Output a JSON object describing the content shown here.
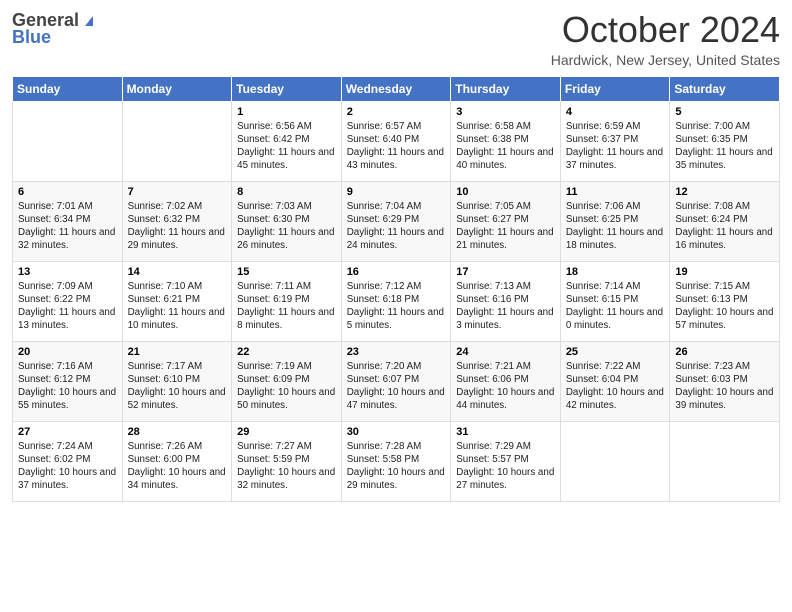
{
  "header": {
    "logo_line1": "General",
    "logo_line2": "Blue",
    "month_title": "October 2024",
    "location": "Hardwick, New Jersey, United States"
  },
  "weekdays": [
    "Sunday",
    "Monday",
    "Tuesday",
    "Wednesday",
    "Thursday",
    "Friday",
    "Saturday"
  ],
  "weeks": [
    [
      null,
      null,
      {
        "day": 1,
        "sunrise": "Sunrise: 6:56 AM",
        "sunset": "Sunset: 6:42 PM",
        "daylight": "Daylight: 11 hours and 45 minutes."
      },
      {
        "day": 2,
        "sunrise": "Sunrise: 6:57 AM",
        "sunset": "Sunset: 6:40 PM",
        "daylight": "Daylight: 11 hours and 43 minutes."
      },
      {
        "day": 3,
        "sunrise": "Sunrise: 6:58 AM",
        "sunset": "Sunset: 6:38 PM",
        "daylight": "Daylight: 11 hours and 40 minutes."
      },
      {
        "day": 4,
        "sunrise": "Sunrise: 6:59 AM",
        "sunset": "Sunset: 6:37 PM",
        "daylight": "Daylight: 11 hours and 37 minutes."
      },
      {
        "day": 5,
        "sunrise": "Sunrise: 7:00 AM",
        "sunset": "Sunset: 6:35 PM",
        "daylight": "Daylight: 11 hours and 35 minutes."
      }
    ],
    [
      {
        "day": 6,
        "sunrise": "Sunrise: 7:01 AM",
        "sunset": "Sunset: 6:34 PM",
        "daylight": "Daylight: 11 hours and 32 minutes."
      },
      {
        "day": 7,
        "sunrise": "Sunrise: 7:02 AM",
        "sunset": "Sunset: 6:32 PM",
        "daylight": "Daylight: 11 hours and 29 minutes."
      },
      {
        "day": 8,
        "sunrise": "Sunrise: 7:03 AM",
        "sunset": "Sunset: 6:30 PM",
        "daylight": "Daylight: 11 hours and 26 minutes."
      },
      {
        "day": 9,
        "sunrise": "Sunrise: 7:04 AM",
        "sunset": "Sunset: 6:29 PM",
        "daylight": "Daylight: 11 hours and 24 minutes."
      },
      {
        "day": 10,
        "sunrise": "Sunrise: 7:05 AM",
        "sunset": "Sunset: 6:27 PM",
        "daylight": "Daylight: 11 hours and 21 minutes."
      },
      {
        "day": 11,
        "sunrise": "Sunrise: 7:06 AM",
        "sunset": "Sunset: 6:25 PM",
        "daylight": "Daylight: 11 hours and 18 minutes."
      },
      {
        "day": 12,
        "sunrise": "Sunrise: 7:08 AM",
        "sunset": "Sunset: 6:24 PM",
        "daylight": "Daylight: 11 hours and 16 minutes."
      }
    ],
    [
      {
        "day": 13,
        "sunrise": "Sunrise: 7:09 AM",
        "sunset": "Sunset: 6:22 PM",
        "daylight": "Daylight: 11 hours and 13 minutes."
      },
      {
        "day": 14,
        "sunrise": "Sunrise: 7:10 AM",
        "sunset": "Sunset: 6:21 PM",
        "daylight": "Daylight: 11 hours and 10 minutes."
      },
      {
        "day": 15,
        "sunrise": "Sunrise: 7:11 AM",
        "sunset": "Sunset: 6:19 PM",
        "daylight": "Daylight: 11 hours and 8 minutes."
      },
      {
        "day": 16,
        "sunrise": "Sunrise: 7:12 AM",
        "sunset": "Sunset: 6:18 PM",
        "daylight": "Daylight: 11 hours and 5 minutes."
      },
      {
        "day": 17,
        "sunrise": "Sunrise: 7:13 AM",
        "sunset": "Sunset: 6:16 PM",
        "daylight": "Daylight: 11 hours and 3 minutes."
      },
      {
        "day": 18,
        "sunrise": "Sunrise: 7:14 AM",
        "sunset": "Sunset: 6:15 PM",
        "daylight": "Daylight: 11 hours and 0 minutes."
      },
      {
        "day": 19,
        "sunrise": "Sunrise: 7:15 AM",
        "sunset": "Sunset: 6:13 PM",
        "daylight": "Daylight: 10 hours and 57 minutes."
      }
    ],
    [
      {
        "day": 20,
        "sunrise": "Sunrise: 7:16 AM",
        "sunset": "Sunset: 6:12 PM",
        "daylight": "Daylight: 10 hours and 55 minutes."
      },
      {
        "day": 21,
        "sunrise": "Sunrise: 7:17 AM",
        "sunset": "Sunset: 6:10 PM",
        "daylight": "Daylight: 10 hours and 52 minutes."
      },
      {
        "day": 22,
        "sunrise": "Sunrise: 7:19 AM",
        "sunset": "Sunset: 6:09 PM",
        "daylight": "Daylight: 10 hours and 50 minutes."
      },
      {
        "day": 23,
        "sunrise": "Sunrise: 7:20 AM",
        "sunset": "Sunset: 6:07 PM",
        "daylight": "Daylight: 10 hours and 47 minutes."
      },
      {
        "day": 24,
        "sunrise": "Sunrise: 7:21 AM",
        "sunset": "Sunset: 6:06 PM",
        "daylight": "Daylight: 10 hours and 44 minutes."
      },
      {
        "day": 25,
        "sunrise": "Sunrise: 7:22 AM",
        "sunset": "Sunset: 6:04 PM",
        "daylight": "Daylight: 10 hours and 42 minutes."
      },
      {
        "day": 26,
        "sunrise": "Sunrise: 7:23 AM",
        "sunset": "Sunset: 6:03 PM",
        "daylight": "Daylight: 10 hours and 39 minutes."
      }
    ],
    [
      {
        "day": 27,
        "sunrise": "Sunrise: 7:24 AM",
        "sunset": "Sunset: 6:02 PM",
        "daylight": "Daylight: 10 hours and 37 minutes."
      },
      {
        "day": 28,
        "sunrise": "Sunrise: 7:26 AM",
        "sunset": "Sunset: 6:00 PM",
        "daylight": "Daylight: 10 hours and 34 minutes."
      },
      {
        "day": 29,
        "sunrise": "Sunrise: 7:27 AM",
        "sunset": "Sunset: 5:59 PM",
        "daylight": "Daylight: 10 hours and 32 minutes."
      },
      {
        "day": 30,
        "sunrise": "Sunrise: 7:28 AM",
        "sunset": "Sunset: 5:58 PM",
        "daylight": "Daylight: 10 hours and 29 minutes."
      },
      {
        "day": 31,
        "sunrise": "Sunrise: 7:29 AM",
        "sunset": "Sunset: 5:57 PM",
        "daylight": "Daylight: 10 hours and 27 minutes."
      },
      null,
      null
    ]
  ]
}
